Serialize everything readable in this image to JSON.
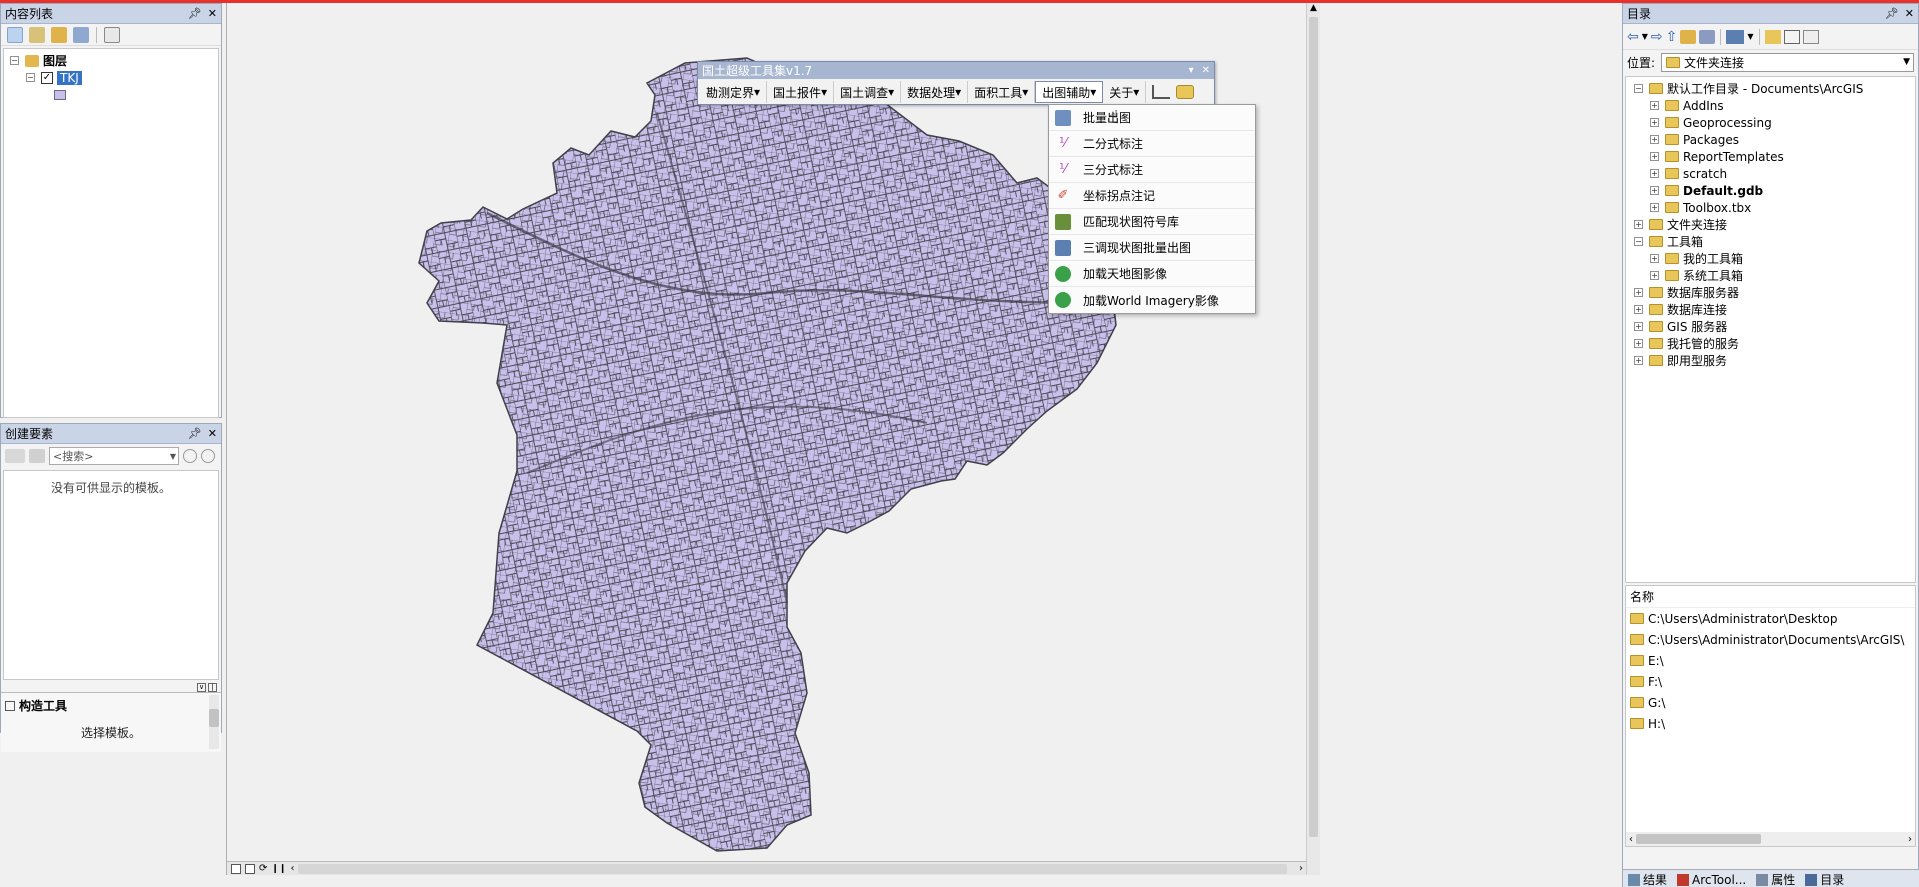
{
  "toc": {
    "title": "内容列表",
    "layers_root": "图层",
    "layer_name": "TKJ"
  },
  "create_features": {
    "title": "创建要素",
    "search_placeholder": "<搜索>",
    "empty_message": "没有可供显示的模板。",
    "construct_tools": "构造工具",
    "select_template": "选择模板。"
  },
  "toolbar": {
    "title": "国土超级工具集v1.7",
    "menus": [
      "勘测定界",
      "国土报件",
      "国土调查",
      "数据处理",
      "面积工具",
      "出图辅助",
      "关于"
    ]
  },
  "dropdown": {
    "items": [
      {
        "label": "批量出图",
        "icon": "batch-map-icon",
        "color": "#6f8fc0"
      },
      {
        "label": "二分式标注",
        "icon": "fraction-label-icon",
        "color": "#b04ab8"
      },
      {
        "label": "三分式标注",
        "icon": "triple-label-icon",
        "color": "#b04ab8"
      },
      {
        "label": "坐标拐点注记",
        "icon": "coordinate-icon",
        "color": "#d04a3a"
      },
      {
        "label": "匹配现状图符号库",
        "icon": "symbol-match-icon",
        "color": "#6a8f3a"
      },
      {
        "label": "三调现状图批量出图",
        "icon": "survey-batch-icon",
        "color": "#5a7fb0"
      },
      {
        "label": "加载天地图影像",
        "icon": "tianditu-icon",
        "color": "#3aa04a"
      },
      {
        "label": "加载World Imagery影像",
        "icon": "world-imagery-icon",
        "color": "#3aa04a"
      }
    ]
  },
  "catalog": {
    "title": "目录",
    "location_label": "位置:",
    "location_value": "文件夹连接",
    "tree": [
      {
        "label": "默认工作目录 - Documents\\ArcGIS",
        "level": 0,
        "expand": "-",
        "bold": false
      },
      {
        "label": "AddIns",
        "level": 1,
        "expand": "+",
        "bold": false
      },
      {
        "label": "Geoprocessing",
        "level": 1,
        "expand": "+",
        "bold": false
      },
      {
        "label": "Packages",
        "level": 1,
        "expand": "+",
        "bold": false
      },
      {
        "label": "ReportTemplates",
        "level": 1,
        "expand": "+",
        "bold": false
      },
      {
        "label": "scratch",
        "level": 1,
        "expand": "+",
        "bold": false
      },
      {
        "label": "Default.gdb",
        "level": 1,
        "expand": "+",
        "bold": true
      },
      {
        "label": "Toolbox.tbx",
        "level": 1,
        "expand": "+",
        "bold": false
      },
      {
        "label": "文件夹连接",
        "level": 0,
        "expand": "+",
        "bold": false
      },
      {
        "label": "工具箱",
        "level": 0,
        "expand": "-",
        "bold": false
      },
      {
        "label": "我的工具箱",
        "level": 1,
        "expand": "+",
        "bold": false
      },
      {
        "label": "系统工具箱",
        "level": 1,
        "expand": "+",
        "bold": false
      },
      {
        "label": "数据库服务器",
        "level": 0,
        "expand": "+",
        "bold": false
      },
      {
        "label": "数据库连接",
        "level": 0,
        "expand": "+",
        "bold": false
      },
      {
        "label": "GIS 服务器",
        "level": 0,
        "expand": "+",
        "bold": false
      },
      {
        "label": "我托管的服务",
        "level": 0,
        "expand": "+",
        "bold": false
      },
      {
        "label": "即用型服务",
        "level": 0,
        "expand": "+",
        "bold": false
      }
    ],
    "name_header": "名称",
    "paths": [
      "C:\\Users\\Administrator\\Desktop",
      "C:\\Users\\Administrator\\Documents\\ArcGIS\\",
      "E:\\",
      "F:\\",
      "G:\\",
      "H:\\"
    ],
    "bottom_tabs": [
      "结果",
      "ArcTool...",
      "属性",
      "目录"
    ]
  },
  "colors": {
    "parcel_fill": "#c9bfeb",
    "parcel_line": "#4a4a52",
    "accent": "#e8312b"
  }
}
